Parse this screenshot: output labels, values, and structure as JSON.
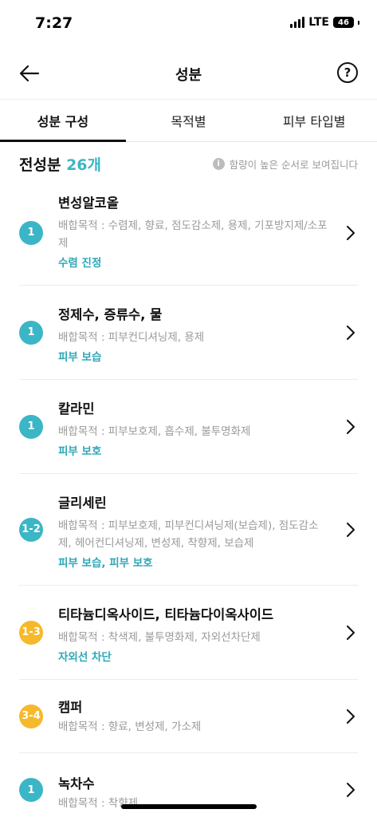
{
  "status": {
    "time": "7:27",
    "network": "LTE",
    "battery": "46"
  },
  "header": {
    "title": "성분",
    "back_icon": "arrow-left-icon",
    "help_label": "?"
  },
  "tabs": [
    {
      "label": "성분 구성",
      "active": true
    },
    {
      "label": "목적별",
      "active": false
    },
    {
      "label": "피부 타입별",
      "active": false
    }
  ],
  "summary": {
    "title": "전성분 ",
    "count": "26개",
    "note": "함량이 높은 순서로 보여집니다",
    "info_icon": "info-icon"
  },
  "colors": {
    "teal": "#3bb6c6",
    "yellow": "#f6b92b",
    "tag": "#2fa8b8"
  },
  "ingredients": [
    {
      "badge": "1",
      "badge_color": "teal",
      "name": "변성알코올",
      "desc": "배합목적 : 수렴제, 향료, 점도감소제, 용제, 기포방지제/소포제",
      "tags": "수렴 진정"
    },
    {
      "badge": "1",
      "badge_color": "teal",
      "name": "정제수, 증류수, 물",
      "desc": "배합목적 : 피부컨디셔닝제, 용제",
      "tags": "피부 보습"
    },
    {
      "badge": "1",
      "badge_color": "teal",
      "name": "칼라민",
      "desc": "배합목적 : 피부보호제, 흡수제, 불투명화제",
      "tags": "피부 보호"
    },
    {
      "badge": "1-2",
      "badge_color": "teal",
      "name": "글리세린",
      "desc": "배합목적 : 피부보호제, 피부컨디셔닝제(보습제), 점도감소제, 헤어컨디셔닝제, 변성제, 착향제, 보습제",
      "tags": "피부 보습, 피부 보호"
    },
    {
      "badge": "1-3",
      "badge_color": "yellow",
      "name": "티타늄디옥사이드, 티타늄다이옥사이드",
      "desc": "배합목적 : 착색제, 불투명화제, 자외선차단제",
      "tags": "자외선 차단"
    },
    {
      "badge": "3-4",
      "badge_color": "yellow",
      "name": "캠퍼",
      "desc": "배합목적 : 향료, 변성제, 가소제",
      "tags": ""
    },
    {
      "badge": "1",
      "badge_color": "teal",
      "name": "녹차수",
      "desc": "배합목적 : 착향제",
      "tags": ""
    }
  ]
}
